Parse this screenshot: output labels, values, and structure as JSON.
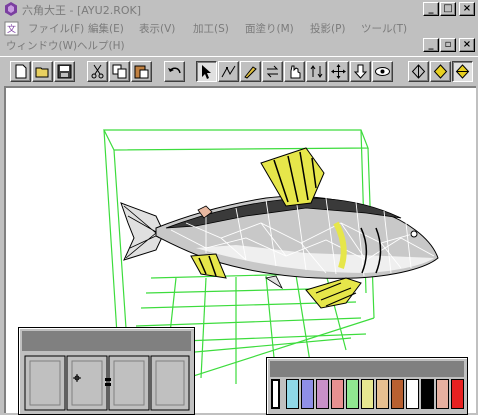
{
  "window": {
    "title": "六角大王 - [AYU2.ROK]",
    "controls": [
      "_",
      "□",
      "×"
    ]
  },
  "menu": {
    "row1": [
      "ファイル(F)",
      "編集(E)",
      "表示(V)",
      "加工(S)",
      "面塗り(M)",
      "投影(P)",
      "ツール(T)"
    ],
    "row2": [
      "ウィンドウ(W)",
      "ヘルプ(H)"
    ],
    "mdi_controls": [
      "_",
      "▫",
      "×"
    ]
  },
  "toolbar": {
    "buttons": [
      {
        "icon": "new-file-icon"
      },
      {
        "icon": "open-folder-icon"
      },
      {
        "icon": "save-disk-icon"
      },
      {
        "icon": "cut-scissors-icon"
      },
      {
        "icon": "copy-icon"
      },
      {
        "icon": "paste-icon"
      },
      {
        "icon": "undo-icon"
      },
      {
        "icon": "select-arrow-icon",
        "pressed": true
      },
      {
        "icon": "add-vertex-icon"
      },
      {
        "icon": "knife-icon"
      },
      {
        "icon": "flip-arrows-icon"
      },
      {
        "icon": "rotate-hand-icon"
      },
      {
        "icon": "symmetry-icon"
      },
      {
        "icon": "move-cross-icon"
      },
      {
        "icon": "push-pull-icon"
      },
      {
        "icon": "view-eye-icon"
      },
      {
        "icon": "shade-gray-icon"
      },
      {
        "icon": "shade-yellow-icon"
      },
      {
        "icon": "shade-yellow-selected-icon",
        "pressed": true
      }
    ]
  },
  "model": {
    "description_label": "",
    "colors": {
      "body": "#c8c8c8",
      "back": "#3a3a3a",
      "fin": "#e6e64a",
      "wire": "#ffffff",
      "box": "#3ddc3d",
      "spot": "#e8b8a0"
    }
  },
  "palette": {
    "colors": [
      "#ffffff",
      "#8fd8e8",
      "#8f8fe8",
      "#c890c8",
      "#e89090",
      "#90e890",
      "#e8e890",
      "#e8c090",
      "#b86030",
      "#ffffff",
      "#000000",
      "#e8b0a0",
      "#e82020"
    ]
  },
  "colors": {
    "window_bg": "#c0c0c0",
    "canvas_bg": "#ffffff",
    "panel_caption": "#808080"
  }
}
